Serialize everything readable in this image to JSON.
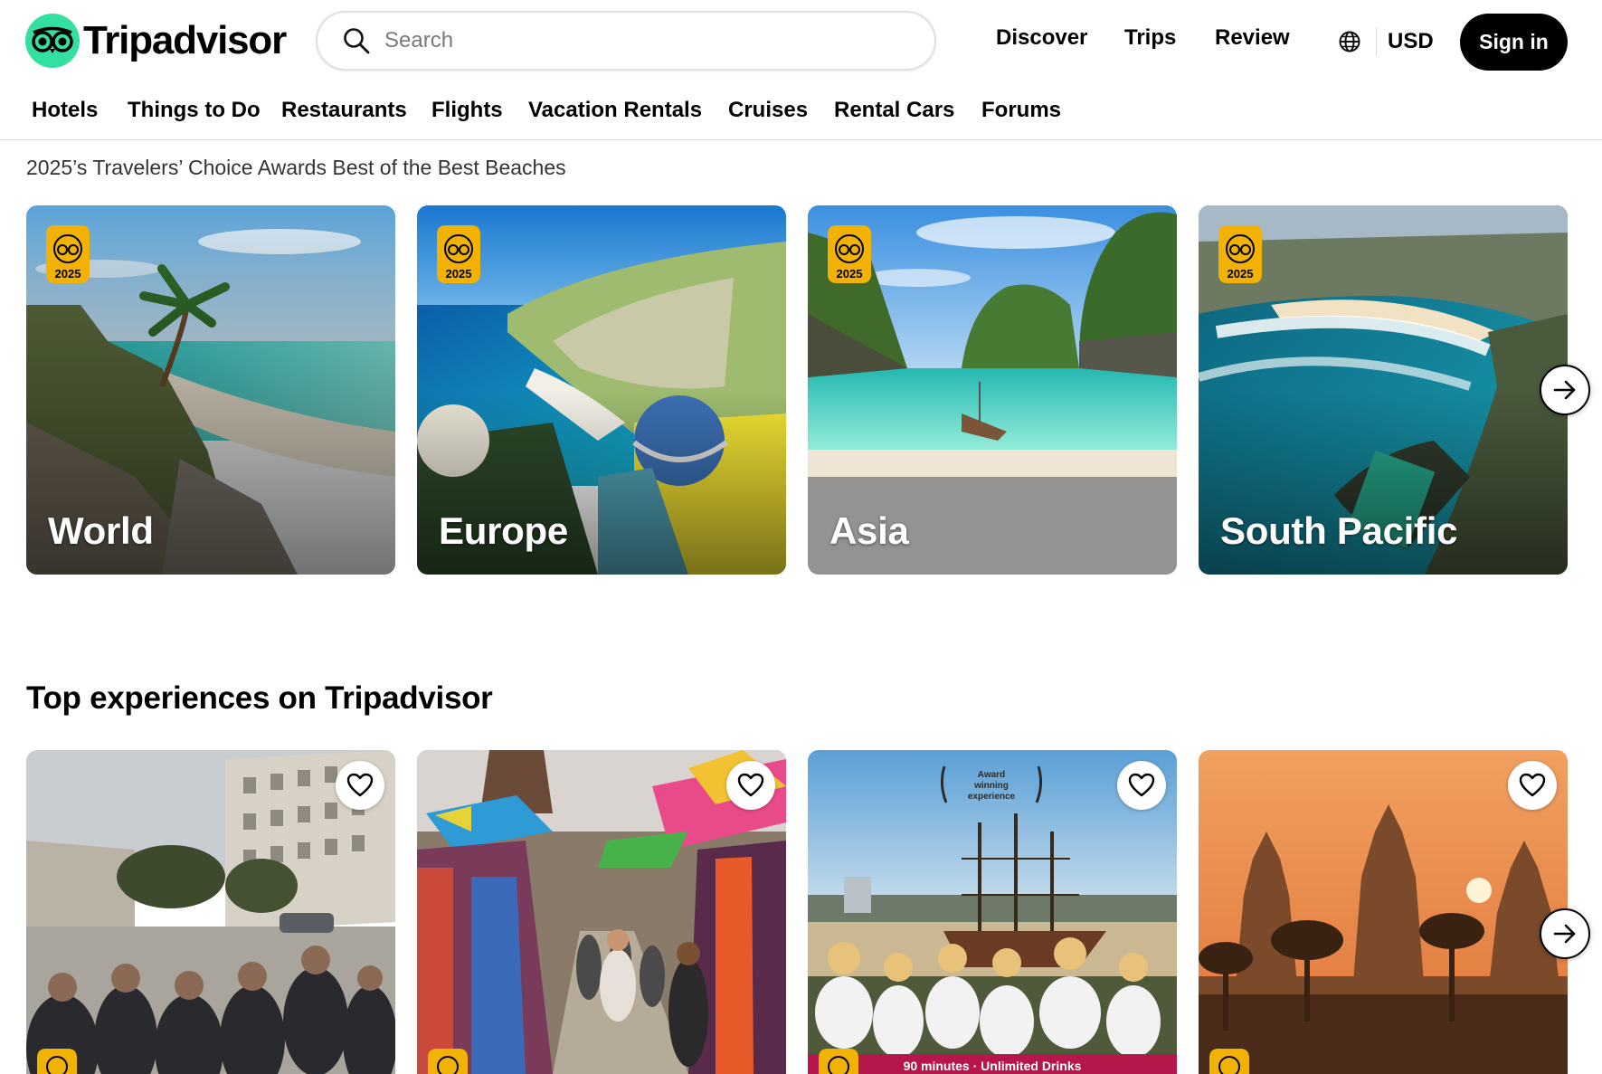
{
  "brand": {
    "name": "Tripadvisor",
    "accent": "#34e0a1"
  },
  "search": {
    "placeholder": "Search"
  },
  "topnav": {
    "discover": "Discover",
    "trips": "Trips",
    "review": "Review",
    "currency": "USD",
    "signin": "Sign in"
  },
  "catnav": [
    "Hotels",
    "Things to Do",
    "Restaurants",
    "Flights",
    "Vacation Rentals",
    "Cruises",
    "Rental Cars",
    "Forums"
  ],
  "awards": {
    "title": "2025’s Travelers’ Choice Awards Best of the Best Beaches",
    "badge_year": "2025",
    "cards": [
      {
        "label": "World"
      },
      {
        "label": "Europe"
      },
      {
        "label": "Asia"
      },
      {
        "label": "South Pacific"
      }
    ]
  },
  "experiences": {
    "title": "Top experiences on Tripadvisor",
    "cruise_laurel_text": [
      "Award",
      "winning",
      "experience"
    ],
    "cruise_banner_text": "90 minutes · Unlimited Drinks"
  },
  "icons": {
    "logo": "owl-logo-icon",
    "search": "search-icon",
    "globe": "globe-icon",
    "next": "arrow-right-icon",
    "favorite": "heart-outline-icon",
    "award": "travelers-choice-badge-icon"
  },
  "colors": {
    "badge_gold": "#f2b203",
    "button_dark": "#000000"
  }
}
